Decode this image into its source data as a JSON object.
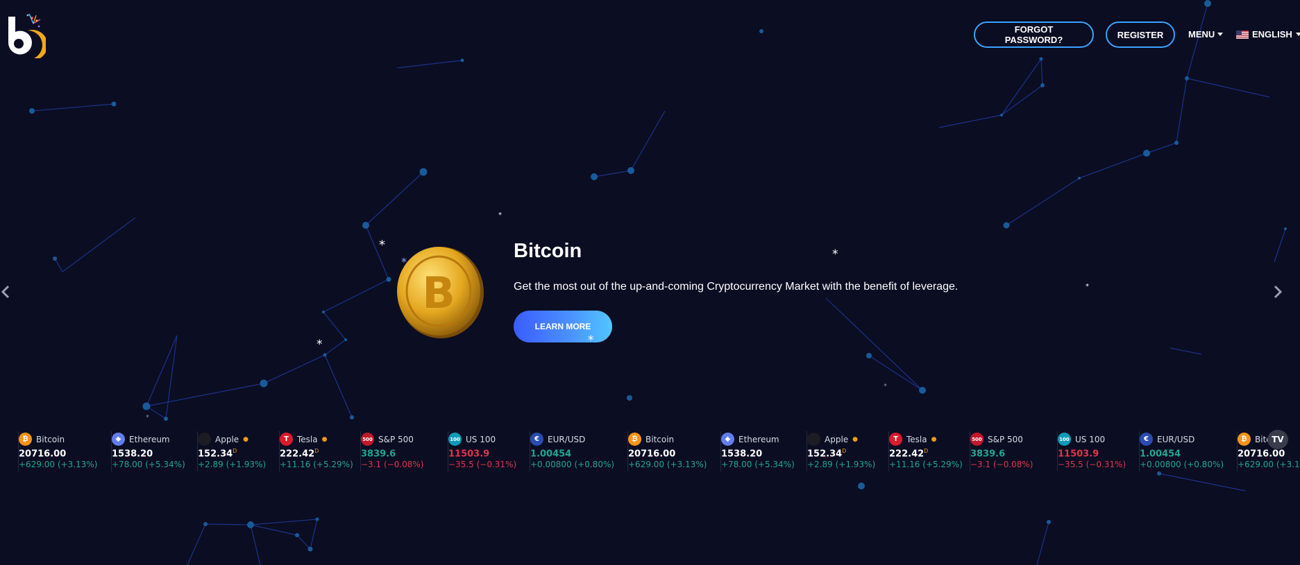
{
  "header": {
    "forgot_password": "FORGOT PASSWORD?",
    "register": "REGISTER",
    "menu": "MENU",
    "language": "ENGLISH"
  },
  "slide": {
    "title": "Bitcoin",
    "text": "Get the most out of the up-and-coming Cryptocurrency Market with the benefit of leverage.",
    "button": "LEARN MORE"
  },
  "ticker": [
    {
      "name": "Bitcoin",
      "price": "20716.00",
      "suffix": "",
      "change": "+629.00 (+3.13%)",
      "dir": "up",
      "icon": "bitcoin-icon",
      "color": "#f7931a",
      "glyph": "₿",
      "dot": false
    },
    {
      "name": "Ethereum",
      "price": "1538.20",
      "suffix": "",
      "change": "+78.00 (+5.34%)",
      "dir": "up",
      "icon": "ethereum-icon",
      "color": "#627eea",
      "glyph": "◆",
      "dot": false
    },
    {
      "name": "Apple",
      "price": "152.34",
      "suffix": "D",
      "change": "+2.89 (+1.93%)",
      "dir": "up",
      "icon": "apple-icon",
      "color": "#1c1c24",
      "glyph": "",
      "dot": true
    },
    {
      "name": "Tesla",
      "price": "222.42",
      "suffix": "D",
      "change": "+11.16 (+5.29%)",
      "dir": "up",
      "icon": "tesla-icon",
      "color": "#d81b2c",
      "glyph": "T",
      "dot": true
    },
    {
      "name": "S&P 500",
      "price": "3839.6",
      "suffix": "",
      "change": "−3.1 (−0.08%)",
      "dir": "down",
      "icon": "sp500-icon",
      "color": "#c0182c",
      "glyph": "500",
      "dot": false,
      "priceColor": "up"
    },
    {
      "name": "US 100",
      "price": "11503.9",
      "suffix": "",
      "change": "−35.5 (−0.31%)",
      "dir": "down",
      "icon": "us100-icon",
      "color": "#0e9bb8",
      "glyph": "100",
      "dot": false,
      "priceColor": "down"
    },
    {
      "name": "EUR/USD",
      "price": "1.00454",
      "suffix": "",
      "change": "+0.00800 (+0.80%)",
      "dir": "up",
      "icon": "eurusd-flags-icon",
      "color": "#2a4bb0",
      "glyph": "€",
      "dot": false,
      "priceColor": "up"
    }
  ],
  "ticker_badge": "TV",
  "colors": {
    "background": "#0b0d22",
    "accent_border": "#3aa3ff",
    "up": "#1fa68f",
    "down": "#e0344a"
  }
}
